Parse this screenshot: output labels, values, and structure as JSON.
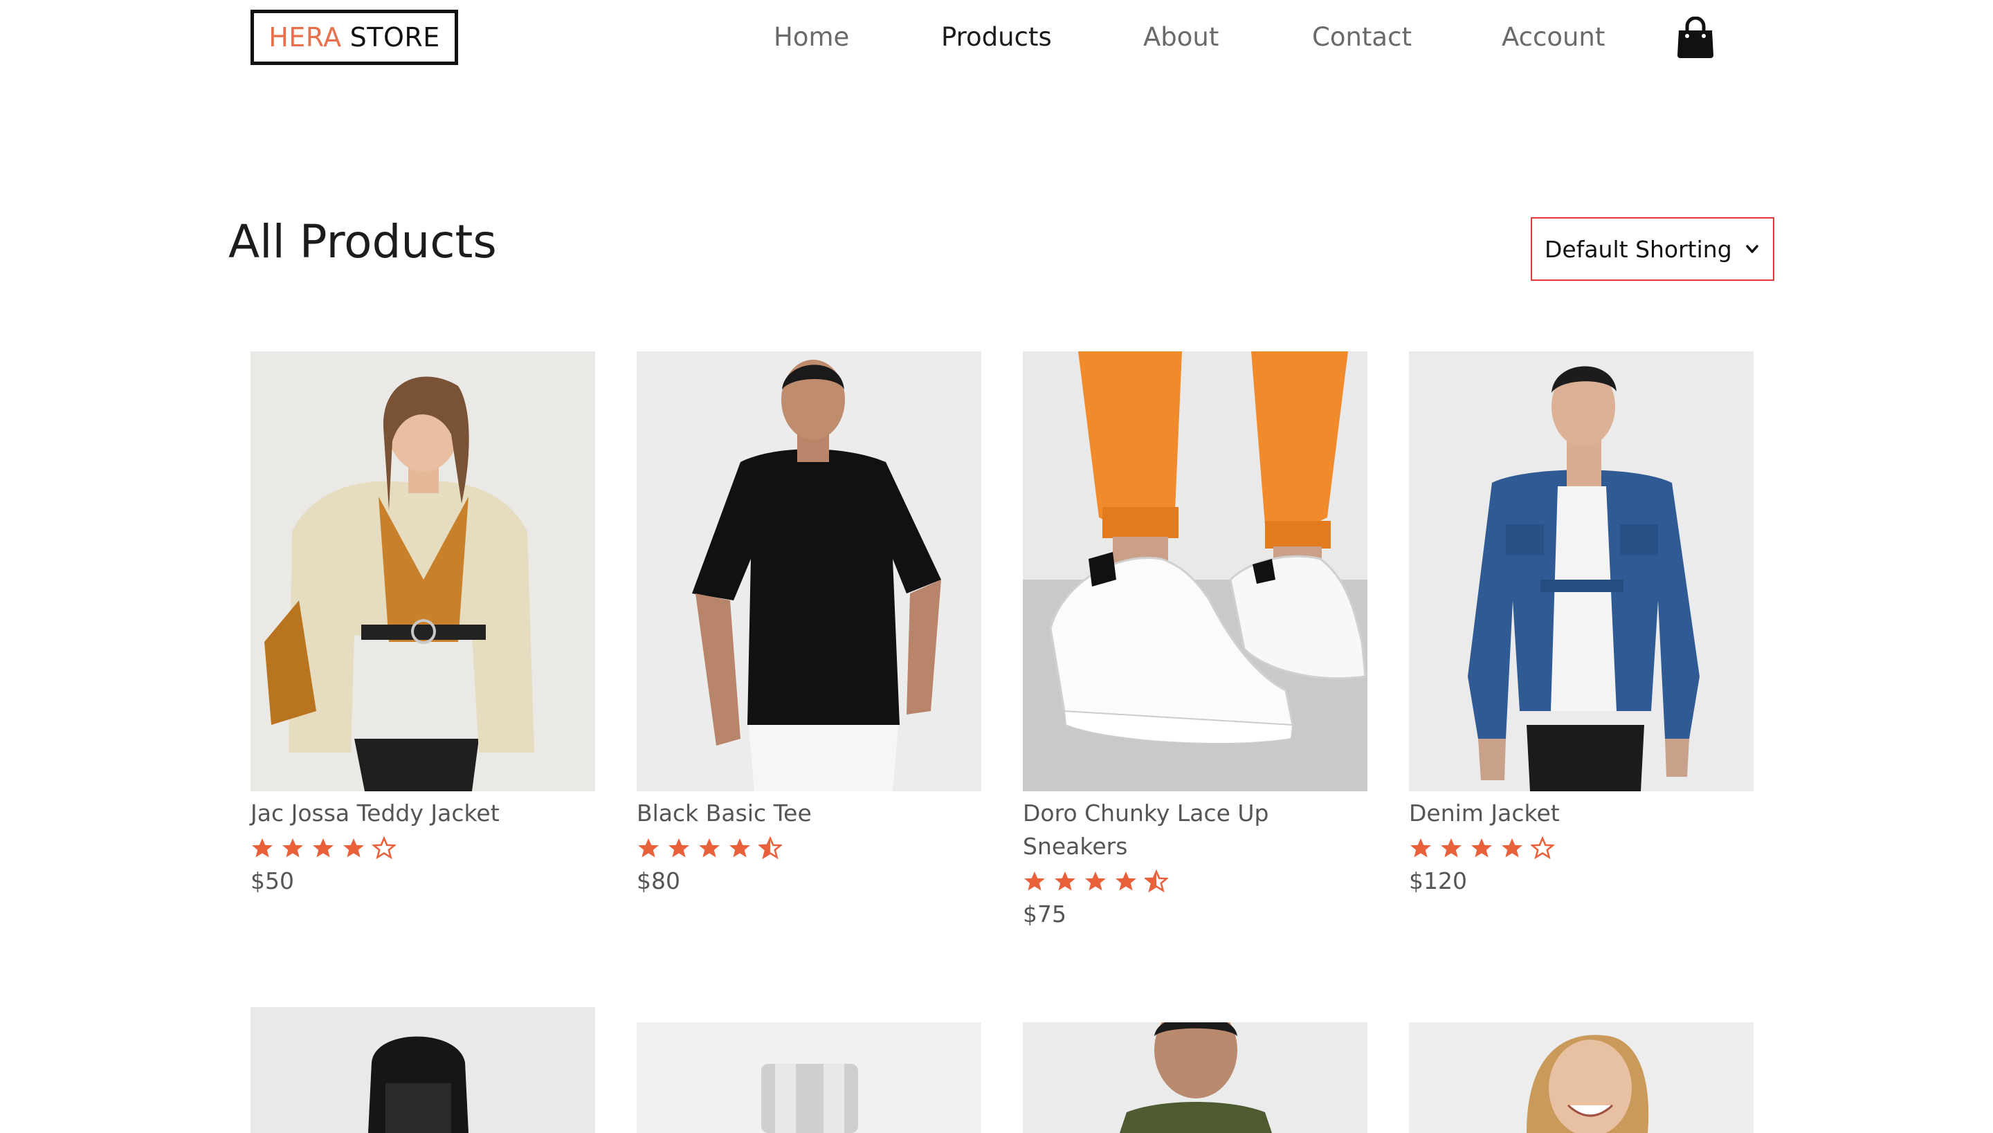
{
  "brand": {
    "accent": "HERA",
    "rest": "STORE",
    "accent_color": "#e8704a"
  },
  "nav": {
    "items": [
      {
        "label": "Home"
      },
      {
        "label": "Products",
        "active": true
      },
      {
        "label": "About"
      },
      {
        "label": "Contact"
      },
      {
        "label": "Account"
      }
    ],
    "cart_icon": "shopping-bag-icon"
  },
  "main": {
    "title": "All Products",
    "sort": {
      "selected": "Default Shorting",
      "border_color": "#e53935"
    }
  },
  "products": [
    {
      "name": "Jac Jossa Teddy Jacket",
      "rating": 4,
      "price": "$50"
    },
    {
      "name": "Black Basic Tee",
      "rating": 4.5,
      "price": "$80"
    },
    {
      "name": "Doro Chunky Lace Up Sneakers",
      "rating": 4.5,
      "price": "$75"
    },
    {
      "name": "Denim Jacket",
      "rating": 4,
      "price": "$120"
    }
  ],
  "star_color": "#e8613b"
}
